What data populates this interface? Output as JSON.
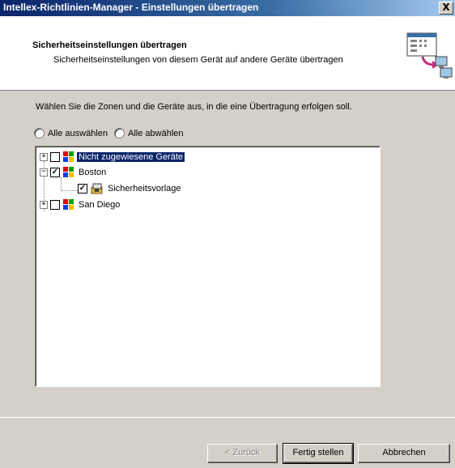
{
  "window": {
    "title": "Intellex-Richtlinien-Manager - Einstellungen übertragen",
    "close_label": "X"
  },
  "header": {
    "title": "Sicherheitseinstellungen übertragen",
    "description": "Sicherheitseinstellungen von diesem Gerät auf andere Geräte übertragen"
  },
  "body": {
    "instruction": "Wählen Sie die Zonen und die Geräte aus, in die eine Übertragung erfolgen soll.",
    "select_all": "Alle auswählen",
    "deselect_all": "Alle abwählen"
  },
  "tree": [
    {
      "label": "Nicht zugewiesene Geräte",
      "expander": "+",
      "checked": false,
      "selected": true
    },
    {
      "label": "Boston",
      "expander": "−",
      "checked": true,
      "selected": false
    },
    {
      "label": "Sicherheitsvorlage",
      "checked": true,
      "selected": false
    },
    {
      "label": "San Diego",
      "expander": "+",
      "checked": false,
      "selected": false
    }
  ],
  "footer": {
    "back": "< Zurück",
    "finish": "Fertig stellen",
    "cancel": "Abbrechen"
  },
  "colors": {
    "titlebar": "#0a246a",
    "dialog": "#d4d0c8",
    "selection": "#0a246a"
  }
}
